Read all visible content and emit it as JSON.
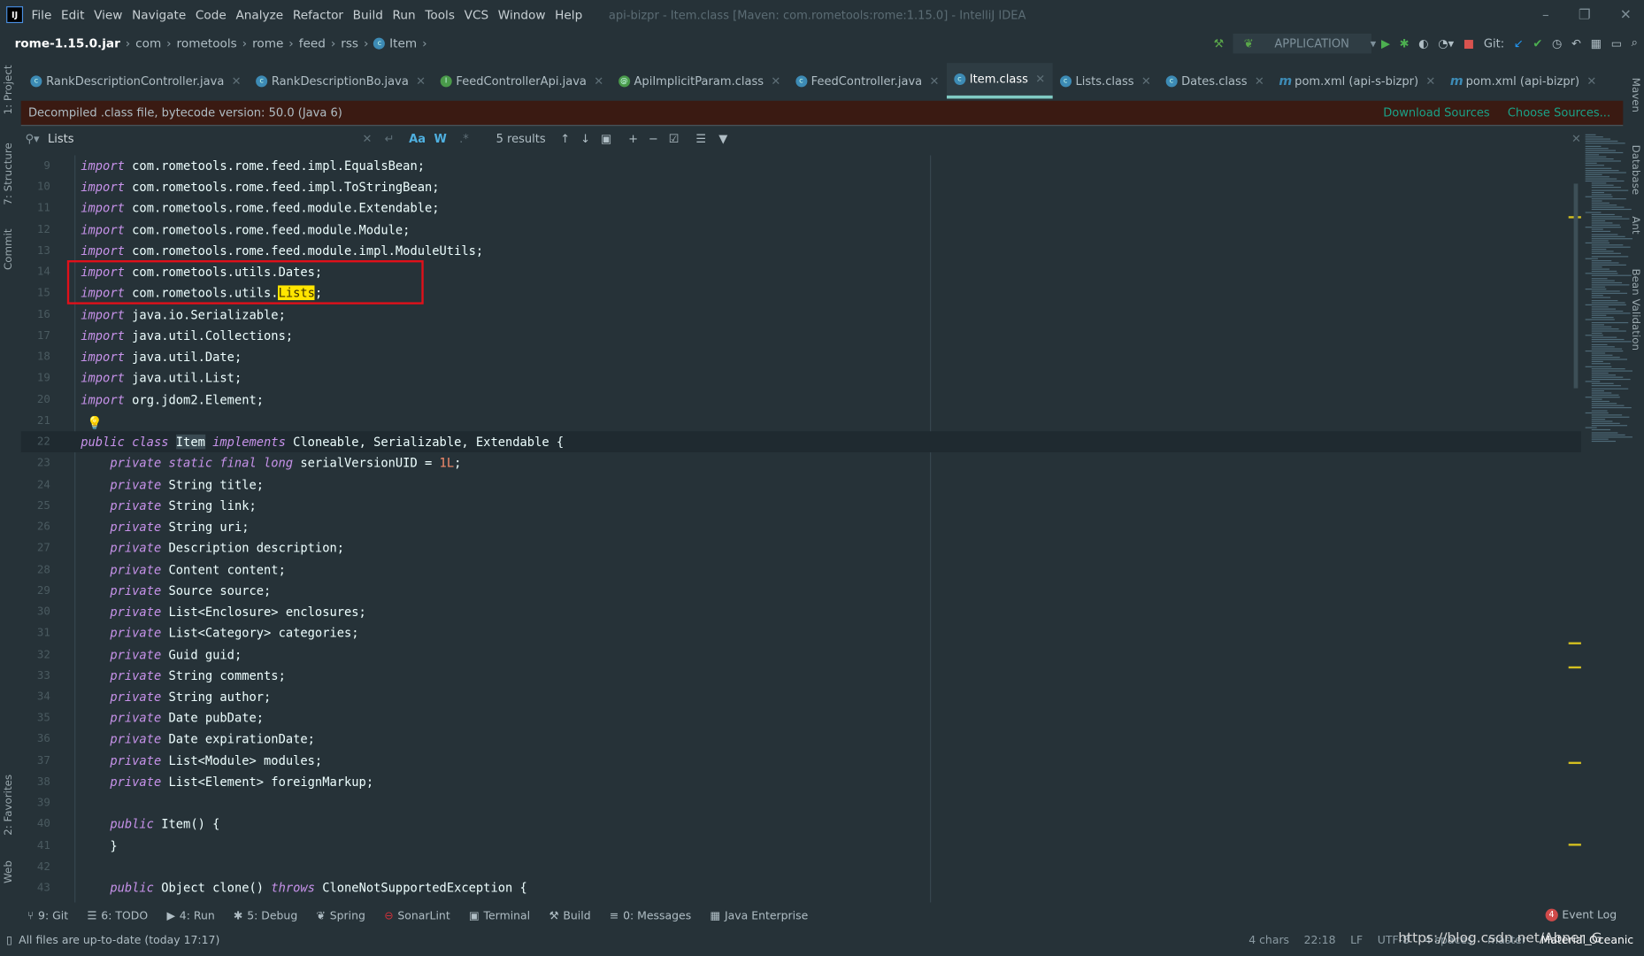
{
  "menu": [
    "File",
    "Edit",
    "View",
    "Navigate",
    "Code",
    "Analyze",
    "Refactor",
    "Build",
    "Run",
    "Tools",
    "VCS",
    "Window",
    "Help"
  ],
  "window_title": "api-bizpr - Item.class [Maven: com.rometools:rome:1.15.0] - IntelliJ IDEA",
  "breadcrumb": [
    "rome-1.15.0.jar",
    "com",
    "rometools",
    "rome",
    "feed",
    "rss",
    "Item"
  ],
  "run_config": "APPLICATION",
  "git_label": "Git:",
  "tabs": [
    {
      "label": "RankDescriptionController.java",
      "icon": "class-icon",
      "active": false
    },
    {
      "label": "RankDescriptionBo.java",
      "icon": "class-icon",
      "active": false
    },
    {
      "label": "FeedControllerApi.java",
      "icon": "interface-icon",
      "active": false
    },
    {
      "label": "ApiImplicitParam.class",
      "icon": "annotation-icon",
      "active": false
    },
    {
      "label": "FeedController.java",
      "icon": "class-icon",
      "active": false
    },
    {
      "label": "Item.class",
      "icon": "class-icon",
      "active": true
    },
    {
      "label": "Lists.class",
      "icon": "class-icon",
      "active": false
    },
    {
      "label": "Dates.class",
      "icon": "class-icon",
      "active": false
    },
    {
      "label": "pom.xml (api-s-bizpr)",
      "icon": "maven-icon",
      "active": false
    },
    {
      "label": "pom.xml (api-bizpr)",
      "icon": "maven-icon",
      "active": false
    }
  ],
  "banner": {
    "text": "Decompiled .class file, bytecode version: 50.0 (Java 6)",
    "download": "Download Sources",
    "choose": "Choose Sources..."
  },
  "search": {
    "query": "Lists",
    "results": "5 results",
    "match_case": "Aa",
    "words": "W",
    "regex": ".*"
  },
  "left_tools": [
    "1: Project",
    "7: Structure",
    "Commit",
    "2: Favorites",
    "Web"
  ],
  "right_tools": [
    "Maven",
    "Database",
    "Ant",
    "Bean Validation"
  ],
  "code": [
    {
      "n": "9",
      "t": [
        [
          "kw",
          "import"
        ],
        [
          "p",
          " com.rometools.rome.feed.impl.EqualsBean;"
        ]
      ]
    },
    {
      "n": "10",
      "t": [
        [
          "kw",
          "import"
        ],
        [
          "p",
          " com.rometools.rome.feed.impl.ToStringBean;"
        ]
      ]
    },
    {
      "n": "11",
      "t": [
        [
          "kw",
          "import"
        ],
        [
          "p",
          " com.rometools.rome.feed.module.Extendable;"
        ]
      ]
    },
    {
      "n": "12",
      "t": [
        [
          "kw",
          "import"
        ],
        [
          "p",
          " com.rometools.rome.feed.module.Module;"
        ]
      ]
    },
    {
      "n": "13",
      "t": [
        [
          "kw",
          "import"
        ],
        [
          "p",
          " com.rometools.rome.feed.module.impl.ModuleUtils;"
        ]
      ]
    },
    {
      "n": "14",
      "t": [
        [
          "kw",
          "import"
        ],
        [
          "p",
          " com.rometools.utils.Dates;"
        ]
      ]
    },
    {
      "n": "15",
      "t": [
        [
          "kw",
          "import"
        ],
        [
          "p",
          " com.rometools.utils."
        ],
        [
          "hl",
          "Lists"
        ],
        [
          "p",
          ";"
        ]
      ]
    },
    {
      "n": "16",
      "t": [
        [
          "kw",
          "import"
        ],
        [
          "p",
          " java.io.Serializable;"
        ]
      ]
    },
    {
      "n": "17",
      "t": [
        [
          "kw",
          "import"
        ],
        [
          "p",
          " java.util.Collections;"
        ]
      ]
    },
    {
      "n": "18",
      "t": [
        [
          "kw",
          "import"
        ],
        [
          "p",
          " java.util.Date;"
        ]
      ]
    },
    {
      "n": "19",
      "t": [
        [
          "kw",
          "import"
        ],
        [
          "p",
          " java.util.List;"
        ]
      ]
    },
    {
      "n": "20",
      "t": [
        [
          "kw",
          "import"
        ],
        [
          "p",
          " org.jdom2.Element;"
        ]
      ]
    },
    {
      "n": "21",
      "t": []
    },
    {
      "n": "22",
      "cur": true,
      "t": [
        [
          "kw",
          "public class"
        ],
        [
          "p",
          " "
        ],
        [
          "ref",
          "Item"
        ],
        [
          "p",
          " "
        ],
        [
          "kw",
          "implements"
        ],
        [
          "p",
          " Cloneable, Serializable, Extendable {"
        ]
      ]
    },
    {
      "n": "23",
      "t": [
        [
          "p",
          "    "
        ],
        [
          "kw",
          "private static final long"
        ],
        [
          "p",
          " serialVersionUID = "
        ],
        [
          "num",
          "1L"
        ],
        [
          "p",
          ";"
        ]
      ]
    },
    {
      "n": "24",
      "t": [
        [
          "p",
          "    "
        ],
        [
          "kw",
          "private"
        ],
        [
          "p",
          " String title;"
        ]
      ]
    },
    {
      "n": "25",
      "t": [
        [
          "p",
          "    "
        ],
        [
          "kw",
          "private"
        ],
        [
          "p",
          " String link;"
        ]
      ]
    },
    {
      "n": "26",
      "t": [
        [
          "p",
          "    "
        ],
        [
          "kw",
          "private"
        ],
        [
          "p",
          " String uri;"
        ]
      ]
    },
    {
      "n": "27",
      "t": [
        [
          "p",
          "    "
        ],
        [
          "kw",
          "private"
        ],
        [
          "p",
          " Description description;"
        ]
      ]
    },
    {
      "n": "28",
      "t": [
        [
          "p",
          "    "
        ],
        [
          "kw",
          "private"
        ],
        [
          "p",
          " Content content;"
        ]
      ]
    },
    {
      "n": "29",
      "t": [
        [
          "p",
          "    "
        ],
        [
          "kw",
          "private"
        ],
        [
          "p",
          " Source source;"
        ]
      ]
    },
    {
      "n": "30",
      "t": [
        [
          "p",
          "    "
        ],
        [
          "kw",
          "private"
        ],
        [
          "p",
          " List<Enclosure> enclosures;"
        ]
      ]
    },
    {
      "n": "31",
      "t": [
        [
          "p",
          "    "
        ],
        [
          "kw",
          "private"
        ],
        [
          "p",
          " List<Category> categories;"
        ]
      ]
    },
    {
      "n": "32",
      "t": [
        [
          "p",
          "    "
        ],
        [
          "kw",
          "private"
        ],
        [
          "p",
          " Guid guid;"
        ]
      ]
    },
    {
      "n": "33",
      "t": [
        [
          "p",
          "    "
        ],
        [
          "kw",
          "private"
        ],
        [
          "p",
          " String comments;"
        ]
      ]
    },
    {
      "n": "34",
      "t": [
        [
          "p",
          "    "
        ],
        [
          "kw",
          "private"
        ],
        [
          "p",
          " String author;"
        ]
      ]
    },
    {
      "n": "35",
      "t": [
        [
          "p",
          "    "
        ],
        [
          "kw",
          "private"
        ],
        [
          "p",
          " Date pubDate;"
        ]
      ]
    },
    {
      "n": "36",
      "t": [
        [
          "p",
          "    "
        ],
        [
          "kw",
          "private"
        ],
        [
          "p",
          " Date expirationDate;"
        ]
      ]
    },
    {
      "n": "37",
      "t": [
        [
          "p",
          "    "
        ],
        [
          "kw",
          "private"
        ],
        [
          "p",
          " List<Module> modules;"
        ]
      ]
    },
    {
      "n": "38",
      "t": [
        [
          "p",
          "    "
        ],
        [
          "kw",
          "private"
        ],
        [
          "p",
          " List<Element> foreignMarkup;"
        ]
      ]
    },
    {
      "n": "39",
      "t": []
    },
    {
      "n": "40",
      "t": [
        [
          "p",
          "    "
        ],
        [
          "kw",
          "public"
        ],
        [
          "p",
          " Item() {"
        ]
      ]
    },
    {
      "n": "41",
      "t": [
        [
          "p",
          "    }"
        ]
      ]
    },
    {
      "n": "42",
      "t": []
    },
    {
      "n": "43",
      "t": [
        [
          "p",
          "    "
        ],
        [
          "kw",
          "public"
        ],
        [
          "p",
          " Object clone() "
        ],
        [
          "kw",
          "throws"
        ],
        [
          "p",
          " CloneNotSupportedException {"
        ]
      ]
    }
  ],
  "bottom_tools": [
    {
      "label": "9: Git",
      "icon": "git-icon"
    },
    {
      "label": "6: TODO",
      "icon": "todo-icon"
    },
    {
      "label": "4: Run",
      "icon": "run-icon"
    },
    {
      "label": "5: Debug",
      "icon": "debug-icon"
    },
    {
      "label": "Spring",
      "icon": "spring-icon"
    },
    {
      "label": "SonarLint",
      "icon": "sonarlint-icon"
    },
    {
      "label": "Terminal",
      "icon": "terminal-icon"
    },
    {
      "label": "Build",
      "icon": "build-icon"
    },
    {
      "label": "0: Messages",
      "icon": "messages-icon"
    },
    {
      "label": "Java Enterprise",
      "icon": "java-enterprise-icon"
    }
  ],
  "event_log": {
    "count": "4",
    "label": "Event Log"
  },
  "status": {
    "message": "All files are up-to-date (today 17:17)",
    "chars": "4 chars",
    "position": "22:18",
    "line_sep": "LF",
    "encoding": "UTF-8",
    "indent": "4 spaces",
    "branch": "master",
    "theme": "Material Oceanic",
    "watermark": "https://blog.csdn.net/Abner_G"
  },
  "colors": {
    "background": "#263238",
    "keyword": "#c792ea",
    "accent": "#80cbc4",
    "search_highlight": "#ffe500",
    "annotation_box": "#e0101a"
  }
}
